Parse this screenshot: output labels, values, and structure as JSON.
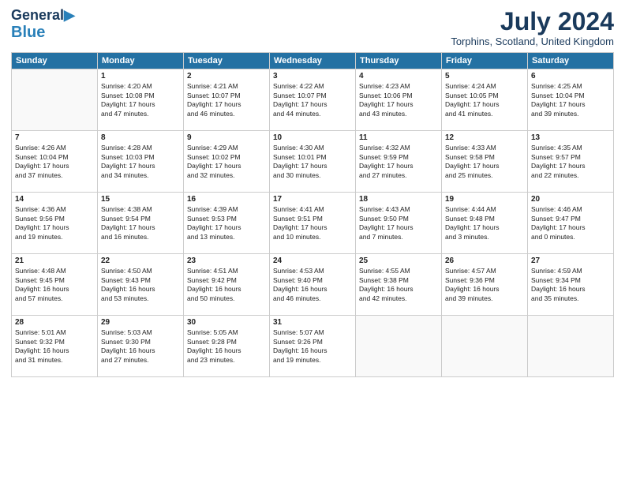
{
  "header": {
    "logo_line1": "General",
    "logo_line2": "Blue",
    "month_title": "July 2024",
    "location": "Torphins, Scotland, United Kingdom"
  },
  "days_of_week": [
    "Sunday",
    "Monday",
    "Tuesday",
    "Wednesday",
    "Thursday",
    "Friday",
    "Saturday"
  ],
  "weeks": [
    [
      {
        "day": "",
        "content": ""
      },
      {
        "day": "1",
        "content": "Sunrise: 4:20 AM\nSunset: 10:08 PM\nDaylight: 17 hours\nand 47 minutes."
      },
      {
        "day": "2",
        "content": "Sunrise: 4:21 AM\nSunset: 10:07 PM\nDaylight: 17 hours\nand 46 minutes."
      },
      {
        "day": "3",
        "content": "Sunrise: 4:22 AM\nSunset: 10:07 PM\nDaylight: 17 hours\nand 44 minutes."
      },
      {
        "day": "4",
        "content": "Sunrise: 4:23 AM\nSunset: 10:06 PM\nDaylight: 17 hours\nand 43 minutes."
      },
      {
        "day": "5",
        "content": "Sunrise: 4:24 AM\nSunset: 10:05 PM\nDaylight: 17 hours\nand 41 minutes."
      },
      {
        "day": "6",
        "content": "Sunrise: 4:25 AM\nSunset: 10:04 PM\nDaylight: 17 hours\nand 39 minutes."
      }
    ],
    [
      {
        "day": "7",
        "content": "Sunrise: 4:26 AM\nSunset: 10:04 PM\nDaylight: 17 hours\nand 37 minutes."
      },
      {
        "day": "8",
        "content": "Sunrise: 4:28 AM\nSunset: 10:03 PM\nDaylight: 17 hours\nand 34 minutes."
      },
      {
        "day": "9",
        "content": "Sunrise: 4:29 AM\nSunset: 10:02 PM\nDaylight: 17 hours\nand 32 minutes."
      },
      {
        "day": "10",
        "content": "Sunrise: 4:30 AM\nSunset: 10:01 PM\nDaylight: 17 hours\nand 30 minutes."
      },
      {
        "day": "11",
        "content": "Sunrise: 4:32 AM\nSunset: 9:59 PM\nDaylight: 17 hours\nand 27 minutes."
      },
      {
        "day": "12",
        "content": "Sunrise: 4:33 AM\nSunset: 9:58 PM\nDaylight: 17 hours\nand 25 minutes."
      },
      {
        "day": "13",
        "content": "Sunrise: 4:35 AM\nSunset: 9:57 PM\nDaylight: 17 hours\nand 22 minutes."
      }
    ],
    [
      {
        "day": "14",
        "content": "Sunrise: 4:36 AM\nSunset: 9:56 PM\nDaylight: 17 hours\nand 19 minutes."
      },
      {
        "day": "15",
        "content": "Sunrise: 4:38 AM\nSunset: 9:54 PM\nDaylight: 17 hours\nand 16 minutes."
      },
      {
        "day": "16",
        "content": "Sunrise: 4:39 AM\nSunset: 9:53 PM\nDaylight: 17 hours\nand 13 minutes."
      },
      {
        "day": "17",
        "content": "Sunrise: 4:41 AM\nSunset: 9:51 PM\nDaylight: 17 hours\nand 10 minutes."
      },
      {
        "day": "18",
        "content": "Sunrise: 4:43 AM\nSunset: 9:50 PM\nDaylight: 17 hours\nand 7 minutes."
      },
      {
        "day": "19",
        "content": "Sunrise: 4:44 AM\nSunset: 9:48 PM\nDaylight: 17 hours\nand 3 minutes."
      },
      {
        "day": "20",
        "content": "Sunrise: 4:46 AM\nSunset: 9:47 PM\nDaylight: 17 hours\nand 0 minutes."
      }
    ],
    [
      {
        "day": "21",
        "content": "Sunrise: 4:48 AM\nSunset: 9:45 PM\nDaylight: 16 hours\nand 57 minutes."
      },
      {
        "day": "22",
        "content": "Sunrise: 4:50 AM\nSunset: 9:43 PM\nDaylight: 16 hours\nand 53 minutes."
      },
      {
        "day": "23",
        "content": "Sunrise: 4:51 AM\nSunset: 9:42 PM\nDaylight: 16 hours\nand 50 minutes."
      },
      {
        "day": "24",
        "content": "Sunrise: 4:53 AM\nSunset: 9:40 PM\nDaylight: 16 hours\nand 46 minutes."
      },
      {
        "day": "25",
        "content": "Sunrise: 4:55 AM\nSunset: 9:38 PM\nDaylight: 16 hours\nand 42 minutes."
      },
      {
        "day": "26",
        "content": "Sunrise: 4:57 AM\nSunset: 9:36 PM\nDaylight: 16 hours\nand 39 minutes."
      },
      {
        "day": "27",
        "content": "Sunrise: 4:59 AM\nSunset: 9:34 PM\nDaylight: 16 hours\nand 35 minutes."
      }
    ],
    [
      {
        "day": "28",
        "content": "Sunrise: 5:01 AM\nSunset: 9:32 PM\nDaylight: 16 hours\nand 31 minutes."
      },
      {
        "day": "29",
        "content": "Sunrise: 5:03 AM\nSunset: 9:30 PM\nDaylight: 16 hours\nand 27 minutes."
      },
      {
        "day": "30",
        "content": "Sunrise: 5:05 AM\nSunset: 9:28 PM\nDaylight: 16 hours\nand 23 minutes."
      },
      {
        "day": "31",
        "content": "Sunrise: 5:07 AM\nSunset: 9:26 PM\nDaylight: 16 hours\nand 19 minutes."
      },
      {
        "day": "",
        "content": ""
      },
      {
        "day": "",
        "content": ""
      },
      {
        "day": "",
        "content": ""
      }
    ]
  ]
}
